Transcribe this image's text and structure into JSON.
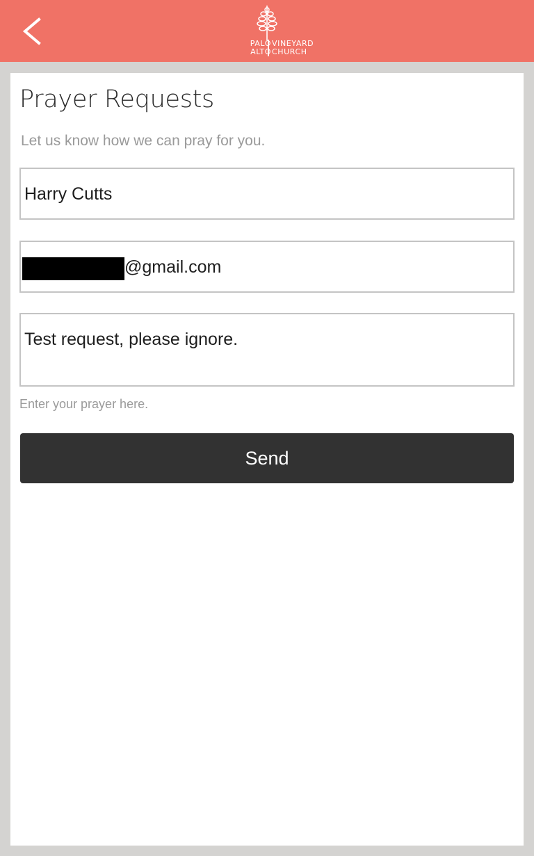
{
  "header": {
    "back_icon": "chevron-left-icon",
    "logo": {
      "left_line1": "PALO",
      "left_line2": "ALTO",
      "right_line1": "VINEYARD",
      "right_line2": "CHURCH",
      "icon": "tree-icon"
    },
    "background_color": "#f07266"
  },
  "form": {
    "title": "Prayer Requests",
    "subtitle": "Let us know how we can pray for you.",
    "name_value": "Harry Cutts",
    "email_value_visible": "@gmail.com",
    "prayer_value": "Test request, please ignore.",
    "prayer_hint": "Enter your prayer here.",
    "send_label": "Send",
    "send_button_color": "#323232"
  }
}
